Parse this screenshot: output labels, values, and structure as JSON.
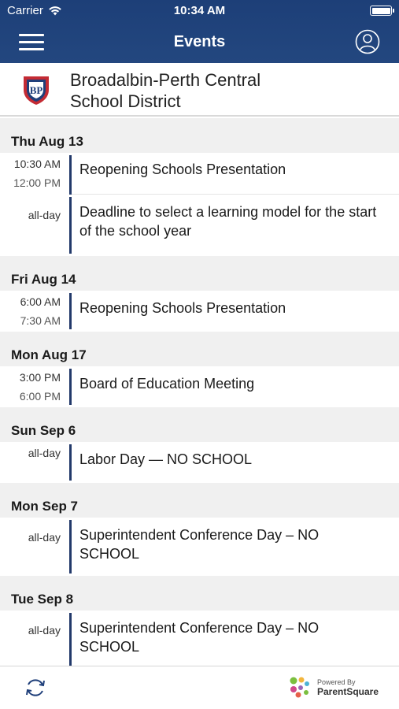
{
  "status_bar": {
    "carrier": "Carrier",
    "time": "10:34 AM"
  },
  "nav": {
    "title": "Events",
    "menu_icon": "hamburger-icon",
    "account_icon": "user-circle-icon"
  },
  "district": {
    "name_line1": "Broadalbin-Perth Central",
    "name_line2": "School District",
    "logo_text": "BP"
  },
  "days": [
    {
      "label": "Thu Aug 13",
      "events": [
        {
          "start": "10:30 AM",
          "end": "12:00 PM",
          "title": "Reopening Schools Presentation"
        },
        {
          "allday": "all-day",
          "title": "Deadline to select a learning model for the start of the school year"
        }
      ]
    },
    {
      "label": "Fri Aug 14",
      "events": [
        {
          "start": "6:00 AM",
          "end": "7:30 AM",
          "title": "Reopening Schools Presentation"
        }
      ]
    },
    {
      "label": "Mon Aug 17",
      "events": [
        {
          "start": "3:00 PM",
          "end": "6:00 PM",
          "title": "Board of Education Meeting"
        }
      ]
    },
    {
      "label": "Sun Sep 6",
      "events": [
        {
          "allday": "all-day",
          "title": "Labor Day — NO SCHOOL"
        }
      ]
    },
    {
      "label": "Mon Sep 7",
      "events": [
        {
          "allday": "all-day",
          "title": "Superintendent Conference Day – NO SCHOOL"
        }
      ]
    },
    {
      "label": "Tue Sep 8",
      "events": [
        {
          "allday": "all-day",
          "title": "Superintendent Conference Day – NO SCHOOL"
        }
      ]
    }
  ],
  "footer": {
    "powered_small": "Powered By",
    "powered_brand": "ParentSquare",
    "refresh_icon": "refresh-icon"
  },
  "colors": {
    "nav_bg": "#1d3f78",
    "event_bar": "#22396a",
    "day_header_bg": "#f0f0f0"
  }
}
